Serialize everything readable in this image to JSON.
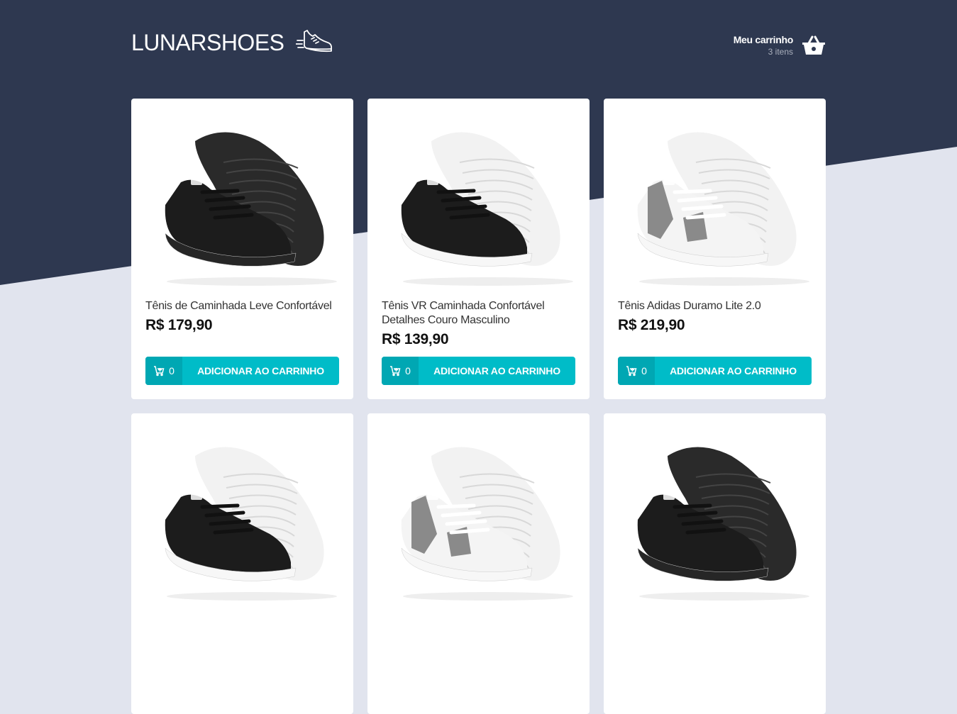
{
  "brand": {
    "name": "LUNARSHOES",
    "logo_icon": "running-shoe-icon"
  },
  "colors": {
    "header_bg": "#2e3850",
    "page_bg": "#e1e4ee",
    "button": "#00bcc8",
    "button_amount": "#00a7b3"
  },
  "cart": {
    "title": "Meu carrinho",
    "count": "3 itens",
    "icon": "basket-icon"
  },
  "products": [
    {
      "name": "Tênis de Caminhada Leve Confortável",
      "price": "R$ 179,90",
      "amount": "0",
      "button_label": "ADICIONAR AO CARRINHO",
      "variant": "black-black"
    },
    {
      "name": "Tênis VR Caminhada Confortável Detalhes Couro Masculino",
      "price": "R$ 139,90",
      "amount": "0",
      "button_label": "ADICIONAR AO CARRINHO",
      "variant": "black-white"
    },
    {
      "name": "Tênis Adidas Duramo Lite 2.0",
      "price": "R$ 219,90",
      "amount": "0",
      "button_label": "ADICIONAR AO CARRINHO",
      "variant": "white-grey"
    },
    {
      "variant": "black-white"
    },
    {
      "variant": "white-grey"
    },
    {
      "variant": "black-black"
    }
  ]
}
